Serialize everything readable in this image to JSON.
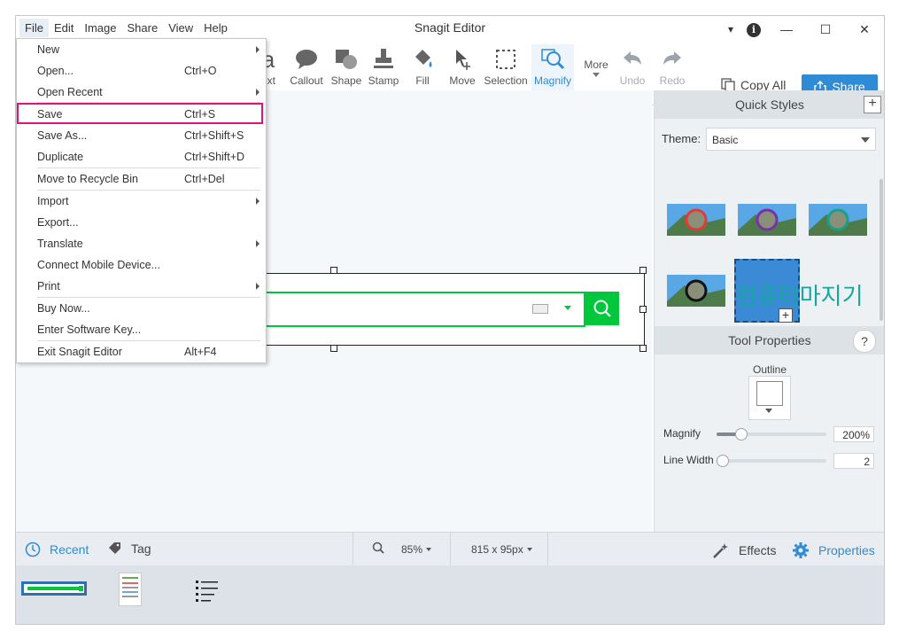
{
  "window": {
    "title": "Snagit Editor",
    "menubar": [
      "File",
      "Edit",
      "Image",
      "Share",
      "View",
      "Help"
    ],
    "controls": {
      "dropdown": "▾",
      "info": "i",
      "minimize": "—",
      "maximize": "☐",
      "close": "✕"
    }
  },
  "toolbar": {
    "tools": [
      {
        "label": "ext",
        "icon": "text-icon"
      },
      {
        "label": "Callout",
        "icon": "callout-icon"
      },
      {
        "label": "Shape",
        "icon": "shape-icon"
      },
      {
        "label": "Stamp",
        "icon": "stamp-icon"
      },
      {
        "label": "Fill",
        "icon": "fill-icon"
      },
      {
        "label": "Move",
        "icon": "move-icon"
      },
      {
        "label": "Selection",
        "icon": "selection-icon"
      },
      {
        "label": "Magnify",
        "icon": "magnify-icon"
      },
      {
        "label": "More",
        "icon": "more-icon"
      },
      {
        "label": "Undo",
        "icon": "undo-icon"
      },
      {
        "label": "Redo",
        "icon": "redo-icon"
      }
    ],
    "copy_all": "Copy All",
    "share": "Share"
  },
  "file_menu": {
    "items": [
      {
        "label": "New",
        "shortcut": "",
        "submenu": true
      },
      {
        "label": "Open...",
        "shortcut": "Ctrl+O",
        "submenu": false
      },
      {
        "label": "Open Recent",
        "shortcut": "",
        "submenu": true
      },
      {
        "label": "Save",
        "shortcut": "Ctrl+S",
        "submenu": false
      },
      {
        "label": "Save As...",
        "shortcut": "Ctrl+Shift+S",
        "submenu": false
      },
      {
        "label": "Duplicate",
        "shortcut": "Ctrl+Shift+D",
        "submenu": false
      },
      {
        "label": "Move to Recycle Bin",
        "shortcut": "Ctrl+Del",
        "submenu": false
      },
      {
        "label": "Import",
        "shortcut": "",
        "submenu": true
      },
      {
        "label": "Export...",
        "shortcut": "",
        "submenu": false
      },
      {
        "label": "Translate",
        "shortcut": "",
        "submenu": true
      },
      {
        "label": "Connect Mobile Device...",
        "shortcut": "",
        "submenu": false
      },
      {
        "label": "Print",
        "shortcut": "",
        "submenu": true
      },
      {
        "label": "Buy Now...",
        "shortcut": "",
        "submenu": false
      },
      {
        "label": "Enter Software Key...",
        "shortcut": "",
        "submenu": false
      },
      {
        "label": "Exit Snagit Editor",
        "shortcut": "Alt+F4",
        "submenu": false
      }
    ],
    "highlighted": "Save",
    "highlight_color": "#e0137c"
  },
  "quick_styles": {
    "title": "Quick Styles",
    "theme_label": "Theme:",
    "theme_value": "Basic",
    "style_colors": [
      "#e53935",
      "#7b2fa8",
      "#1aa089",
      "#111111"
    ],
    "custom_text": "컴퓨터마지기"
  },
  "tool_properties": {
    "title": "Tool Properties",
    "help": "?",
    "outline_label": "Outline",
    "magnify_label": "Magnify",
    "magnify_value": "200%",
    "magnify_level": 0.22,
    "line_width_label": "Line Width",
    "line_width_value": "2",
    "line_width_level": 0.05
  },
  "statusbar": {
    "recent": "Recent",
    "tag": "Tag",
    "zoom": "85%",
    "size": "815 x 95px",
    "effects": "Effects",
    "properties": "Properties"
  },
  "colors": {
    "accent": "#2f8bd3",
    "search_green": "#00c73c"
  }
}
